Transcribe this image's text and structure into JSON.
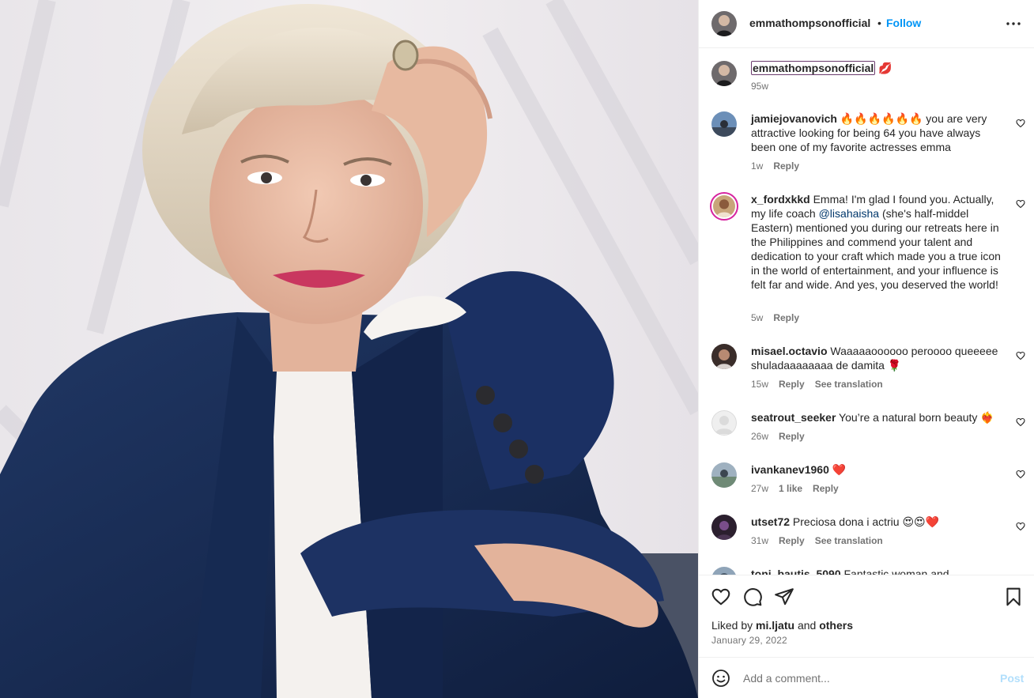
{
  "post": {
    "author": "emmathompsonofficial",
    "separator": "•",
    "follow_label": "Follow",
    "more_icon": "more-horizontal-icon"
  },
  "caption": {
    "user": "emmathompsonofficial",
    "emoji": "💋",
    "time": "95w"
  },
  "comments": [
    {
      "user": "jamiejovanovich",
      "text": "🔥🔥🔥🔥🔥🔥 you are very attractive looking for being 64 you have always been one of my favorite actresses emma",
      "time": "1w",
      "reply": "Reply"
    },
    {
      "user": "x_fordxkkd",
      "text_a": "Emma! I'm glad I found you. Actually, my life coach ",
      "mention": "@lisahaisha",
      "text_b": " (she's half-middel Eastern) mentioned you during our retreats here in the Philippines and commend your talent and dedication to your craft which made you a true icon in the world of entertainment, and your influence is felt far and wide. And yes, you deserved the world!",
      "time": "5w",
      "reply": "Reply"
    },
    {
      "user": "misael.octavio",
      "text": "Waaaaaoooooo peroooo queeeee shuladaaaaaaaa de damita 🌹",
      "time": "15w",
      "reply": "Reply",
      "translate": "See translation"
    },
    {
      "user": "seatrout_seeker",
      "text": "You’re a natural born beauty ❤️‍🔥",
      "time": "26w",
      "reply": "Reply"
    },
    {
      "user": "ivankanev1960",
      "text": "❤️",
      "time": "27w",
      "likes": "1 like",
      "reply": "Reply"
    },
    {
      "user": "utset72",
      "text": "Preciosa dona i actriu 😍😍❤️",
      "time": "31w",
      "reply": "Reply",
      "translate": "See translation"
    },
    {
      "user": "toni_bautis_5090",
      "text": "Fantastic woman and"
    }
  ],
  "actions": {
    "liked_prefix": "Liked by",
    "liked_user": "mi.ljatu",
    "liked_and": "and",
    "liked_others": "others",
    "date": "January 29, 2022"
  },
  "composer": {
    "placeholder": "Add a comment...",
    "post_label": "Post"
  },
  "colors": {
    "accent": "#0095f6",
    "post_disabled": "#b2dffc",
    "jacket": "#1c2f5c"
  }
}
